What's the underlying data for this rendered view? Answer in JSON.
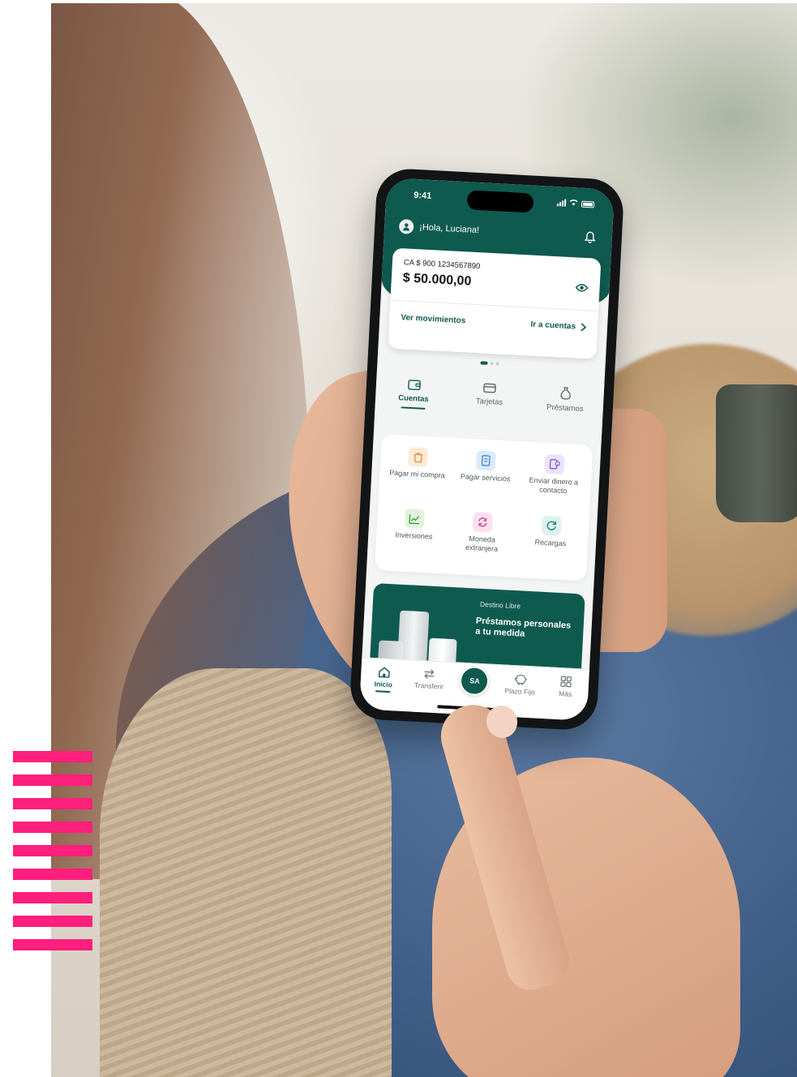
{
  "status_bar": {
    "time": "9:41"
  },
  "header": {
    "greeting": "¡Hola, Luciana!"
  },
  "balance_card": {
    "account_number": "CA $ 900 1234567890",
    "amount": "$ 50.000,00",
    "ver_movimientos": "Ver movimientos",
    "ir_a_cuentas": "Ir a cuentas"
  },
  "tabs": [
    {
      "label": "Cuentas",
      "active": true
    },
    {
      "label": "Tarjetas",
      "active": false
    },
    {
      "label": "Préstamos",
      "active": false
    }
  ],
  "quick_actions": [
    {
      "label": "Pagar mi compra",
      "icon": "shopping-bag-icon"
    },
    {
      "label": "Pagar servicios",
      "icon": "receipt-icon"
    },
    {
      "label": "Enviar dinero a contacto",
      "icon": "send-money-icon"
    },
    {
      "label": "Inversiones",
      "icon": "chart-up-icon"
    },
    {
      "label": "Moneda extranjera",
      "icon": "currency-exchange-icon"
    },
    {
      "label": "Recargas",
      "icon": "refresh-icon"
    }
  ],
  "promo": {
    "tag": "Destino Libre",
    "title": "Préstamos personales a tu medida"
  },
  "bottom_nav": [
    {
      "label": "Inicio",
      "active": true
    },
    {
      "label": "Transferir",
      "active": false
    },
    {
      "label": "SA",
      "center": true
    },
    {
      "label": "Plazo Fijo",
      "active": false
    },
    {
      "label": "Más",
      "active": false
    }
  ],
  "colors": {
    "brand_green": "#0f5a4f",
    "accent_pink": "#ff1f7d"
  }
}
